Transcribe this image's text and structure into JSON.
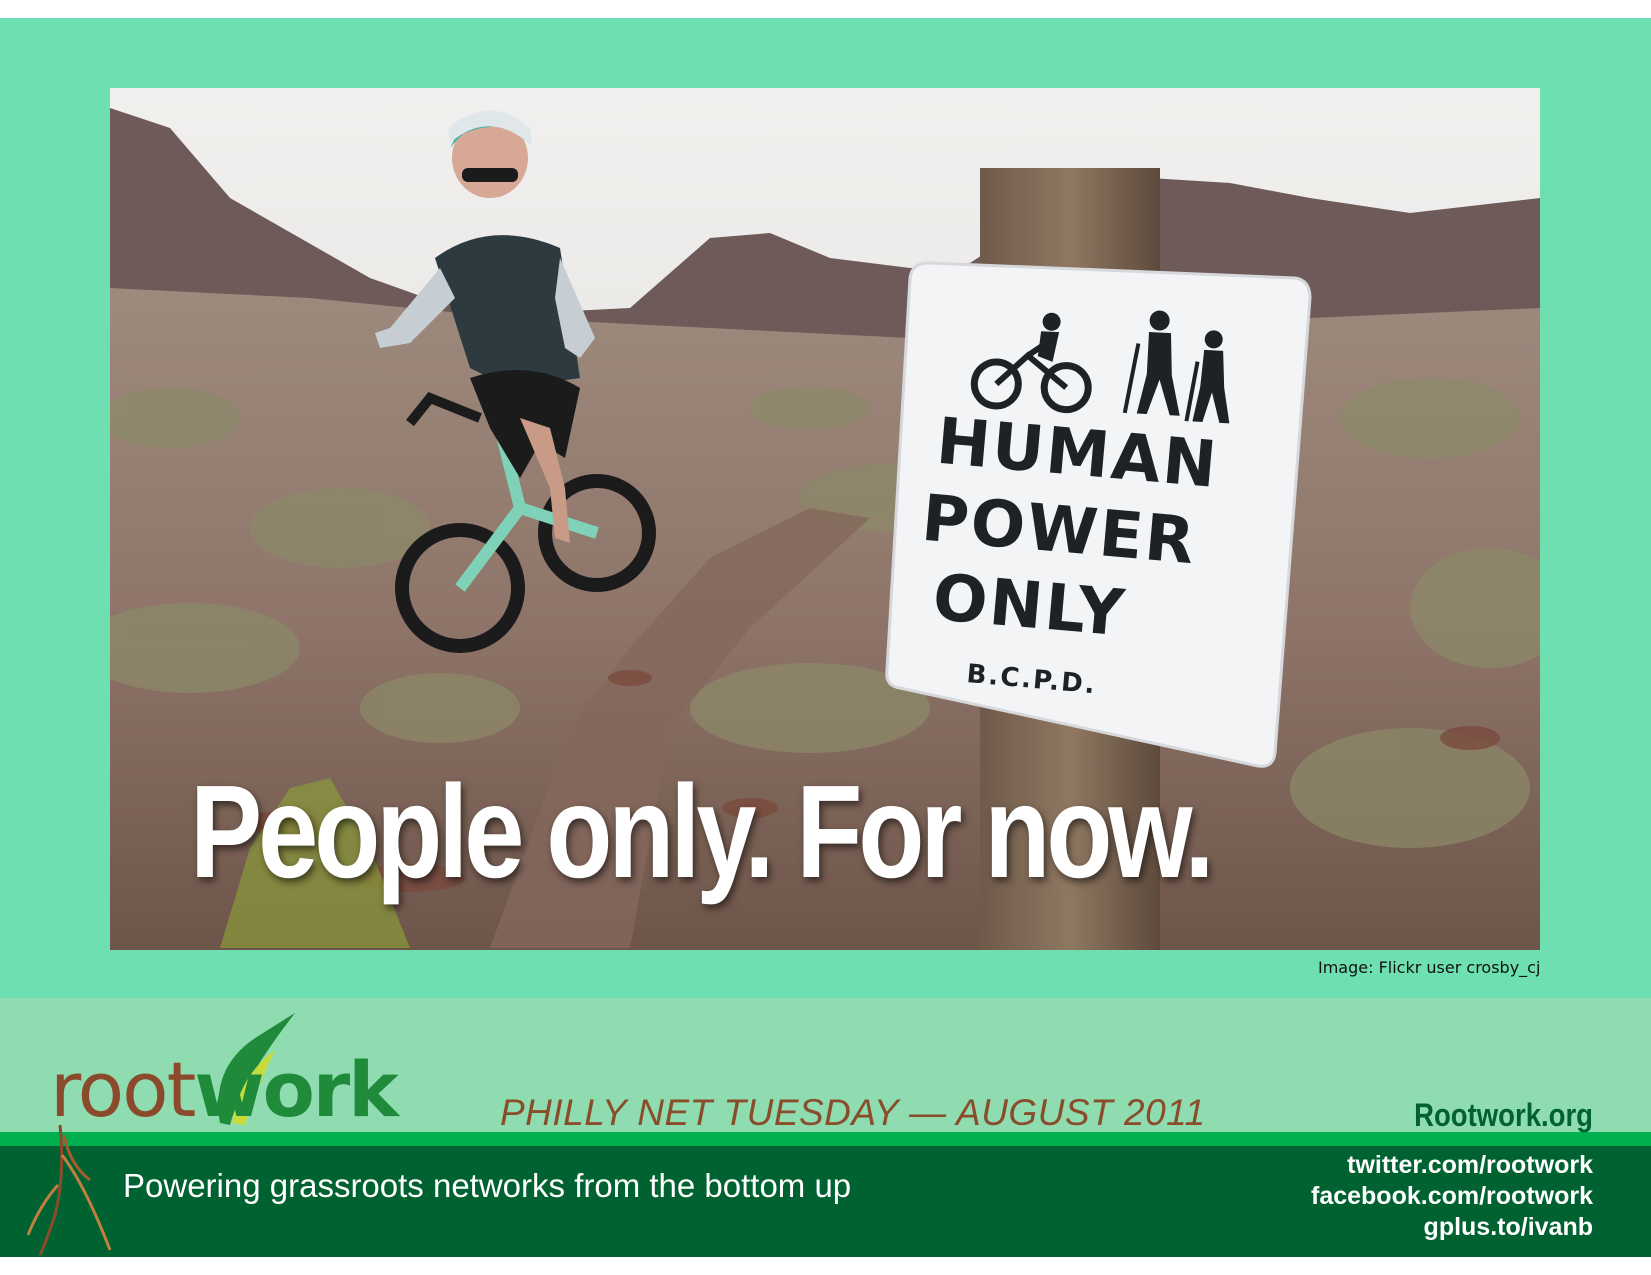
{
  "photo": {
    "sign": {
      "line1": "HUMAN",
      "line2": "POWER",
      "line3": "ONLY",
      "agency": "B.C.P.D."
    },
    "headline": "People only. For now.",
    "credit": "Image: Flickr user crosby_cj"
  },
  "footer": {
    "logo": {
      "part1": "root",
      "part2": "work"
    },
    "event": "PHILLY NET TUESDAY — AUGUST 2011",
    "site": "Rootwork.org",
    "tagline": "Powering grassroots networks from the bottom up",
    "links": [
      "twitter.com/rootwork",
      "facebook.com/rootwork",
      "gplus.to/ivanb"
    ]
  },
  "colors": {
    "slide_green": "#6ddfb0",
    "band_light": "#8fdcb0",
    "band_dark": "#006231",
    "band_stripe": "#00b04e",
    "logo_brown": "#8a4a2b",
    "logo_green": "#1f8a3a"
  },
  "icons": [
    "cyclist-icon",
    "hikers-icon",
    "leaf-sprout-icon",
    "roots-icon"
  ]
}
